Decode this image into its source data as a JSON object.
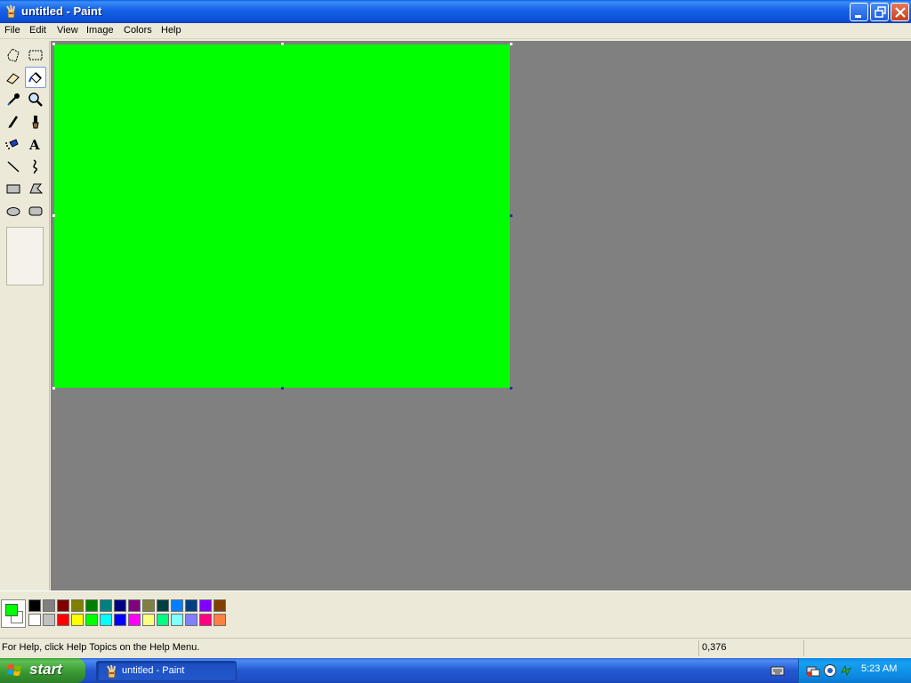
{
  "window": {
    "title": "untitled - Paint"
  },
  "menu": {
    "items": [
      "File",
      "Edit",
      "View",
      "Image",
      "Colors",
      "Help"
    ]
  },
  "toolbox": {
    "tools": [
      {
        "name": "free-form-select",
        "icon": "free-form-select-icon"
      },
      {
        "name": "select",
        "icon": "rect-select-icon"
      },
      {
        "name": "eraser",
        "icon": "eraser-icon"
      },
      {
        "name": "fill-with-color",
        "icon": "paint-bucket-icon",
        "active": true
      },
      {
        "name": "pick-color",
        "icon": "eyedropper-icon"
      },
      {
        "name": "magnifier",
        "icon": "magnifier-icon"
      },
      {
        "name": "pencil",
        "icon": "pencil-icon"
      },
      {
        "name": "brush",
        "icon": "brush-icon"
      },
      {
        "name": "airbrush",
        "icon": "airbrush-icon"
      },
      {
        "name": "text",
        "icon": "text-icon"
      },
      {
        "name": "line",
        "icon": "line-icon"
      },
      {
        "name": "curve",
        "icon": "curve-icon"
      },
      {
        "name": "rectangle",
        "icon": "rectangle-icon"
      },
      {
        "name": "polygon",
        "icon": "polygon-icon"
      },
      {
        "name": "ellipse",
        "icon": "ellipse-icon"
      },
      {
        "name": "rounded-rectangle",
        "icon": "rounded-rectangle-icon"
      }
    ]
  },
  "canvas": {
    "fill_color": "#00ff00",
    "workspace_color": "#808080"
  },
  "colors": {
    "foreground": "#00ff00",
    "background": "#ffffff",
    "palette_top": [
      "#000000",
      "#808080",
      "#800000",
      "#808000",
      "#008000",
      "#008080",
      "#000080",
      "#800080",
      "#808040",
      "#004040",
      "#0080ff",
      "#004080",
      "#8000ff",
      "#804000"
    ],
    "palette_bottom": [
      "#ffffff",
      "#c0c0c0",
      "#ff0000",
      "#ffff00",
      "#00ff00",
      "#00ffff",
      "#0000ff",
      "#ff00ff",
      "#ffff80",
      "#00ff80",
      "#80ffff",
      "#8080ff",
      "#ff0080",
      "#ff8040"
    ]
  },
  "status": {
    "help_text": "For Help, click Help Topics on the Help Menu.",
    "coordinates": "0,376"
  },
  "taskbar": {
    "start_label": "start",
    "task_label": "untitled - Paint",
    "clock": "5:23 AM",
    "tray_icons": [
      "keyboard-icon",
      "network-icon",
      "security-icon",
      "sync-icon"
    ]
  }
}
